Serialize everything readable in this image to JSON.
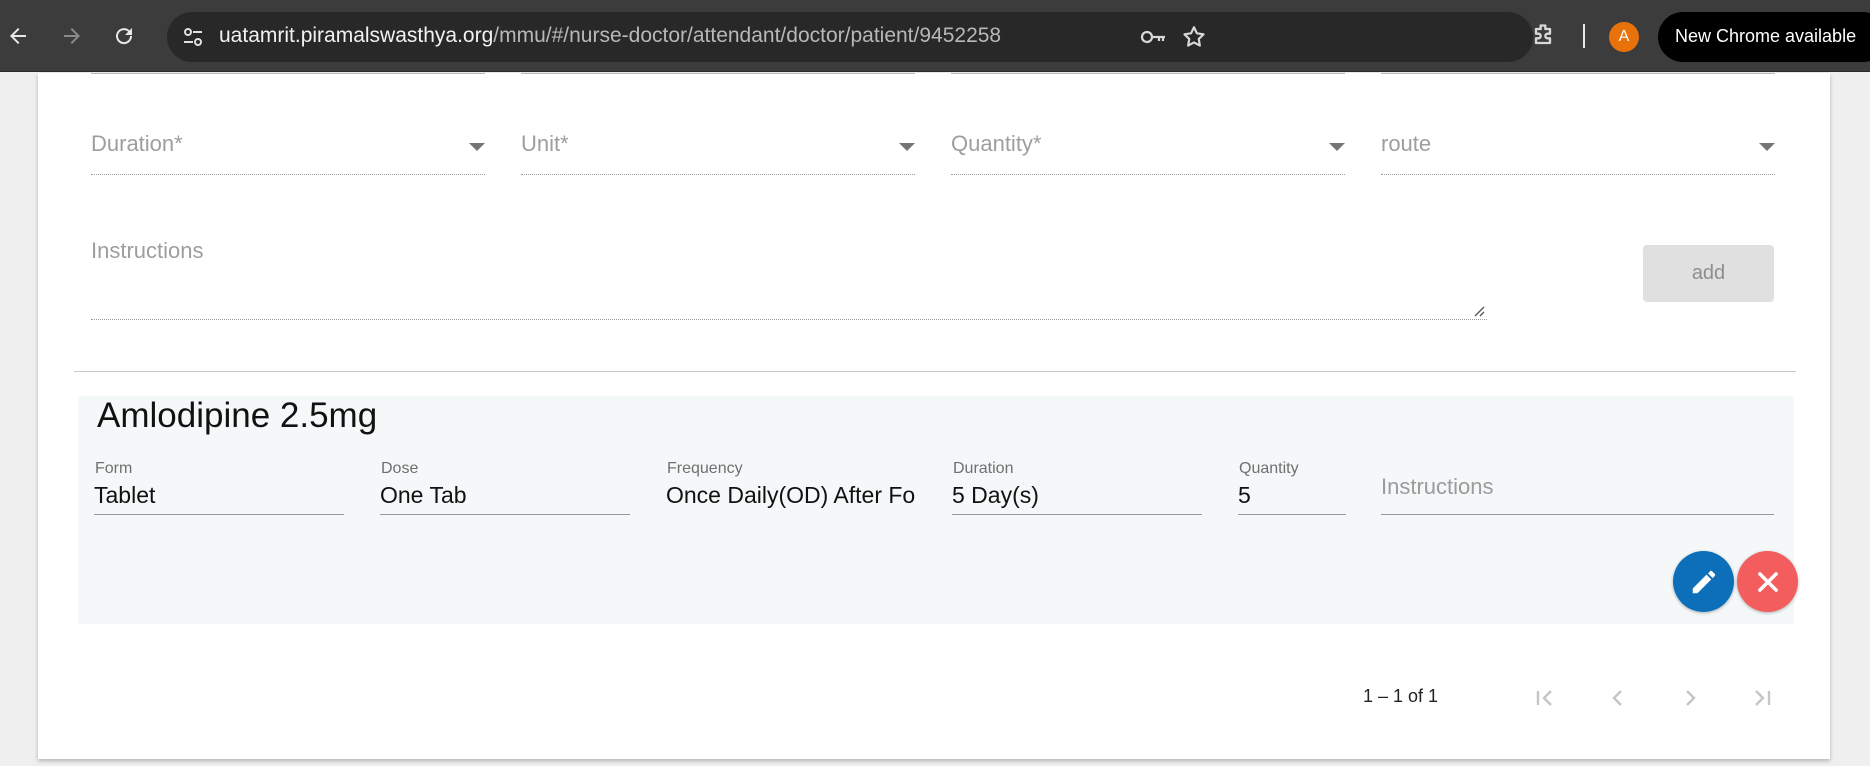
{
  "browser": {
    "url_host": "uatamrit.piramalswasthya.org",
    "url_path": "/mmu/#/nurse-doctor/attendant/doctor/patient/9452258",
    "avatar_initial": "A",
    "update_label": "New Chrome available"
  },
  "form": {
    "duration_label": "Duration*",
    "unit_label": "Unit*",
    "quantity_label": "Quantity*",
    "route_label": "route",
    "instructions_label": "Instructions",
    "add_label": "add"
  },
  "medication": {
    "name": "Amlodipine 2.5mg",
    "form_caption": "Form",
    "form_value": "Tablet",
    "dose_caption": "Dose",
    "dose_value": "One Tab",
    "frequency_caption": "Frequency",
    "frequency_value": "Once Daily(OD) After Food",
    "duration_caption": "Duration",
    "duration_value": "5 Day(s)",
    "quantity_caption": "Quantity",
    "quantity_value": "5",
    "instructions_placeholder": "Instructions"
  },
  "pagination": {
    "range": "1 – 1 of 1"
  },
  "colors": {
    "edit": "#0d6fb9",
    "remove": "#f45d5d"
  }
}
